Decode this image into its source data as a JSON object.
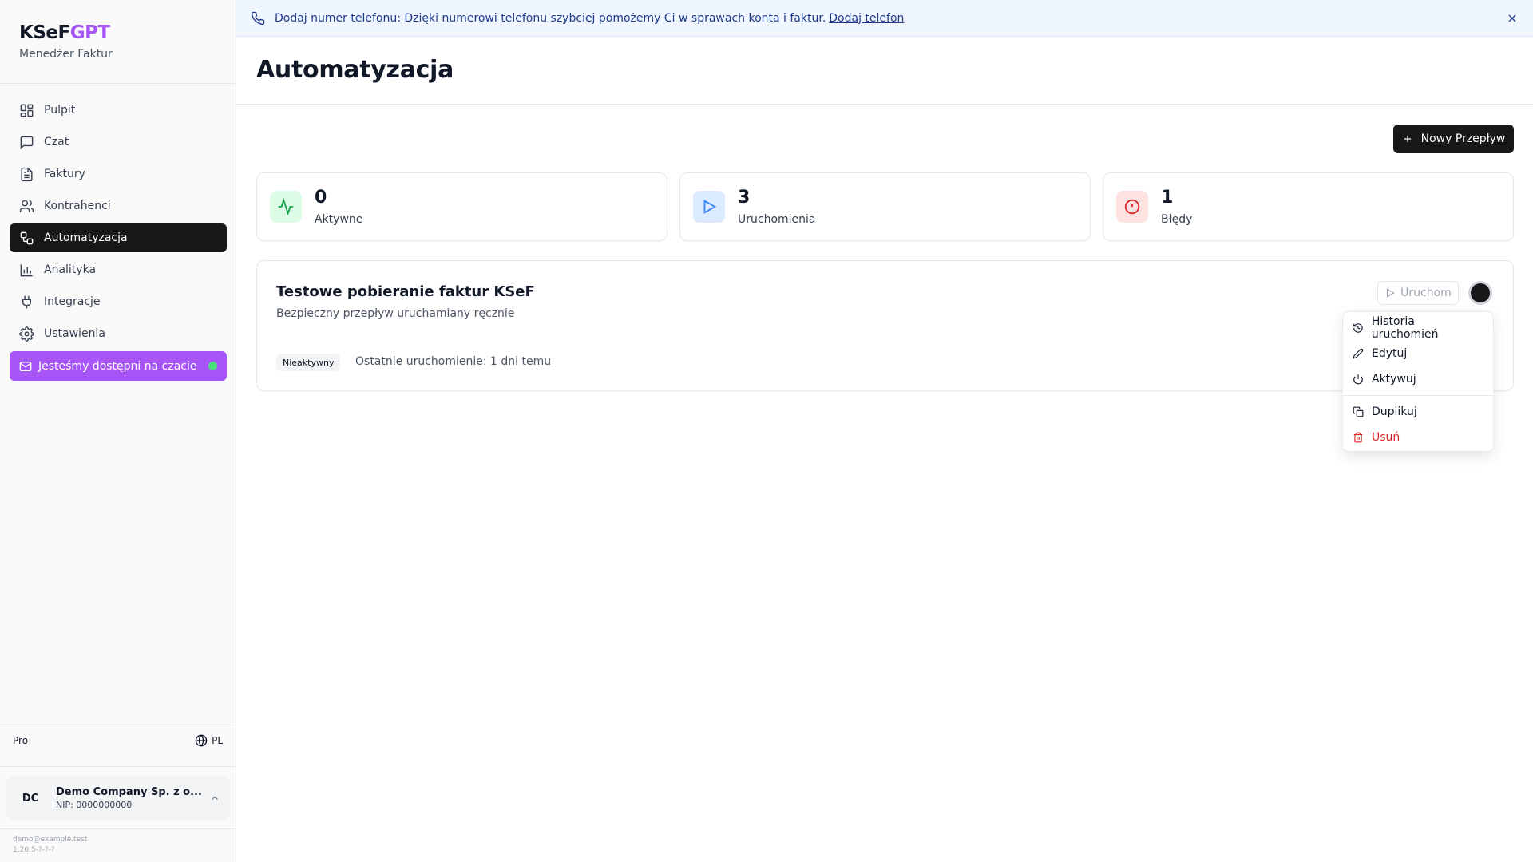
{
  "brand": {
    "logo_main": "KSeF",
    "logo_accent": "GPT",
    "subtitle": "Menedżer Faktur"
  },
  "sidebar": {
    "items": [
      {
        "label": "Pulpit",
        "icon": "dashboard-icon"
      },
      {
        "label": "Czat",
        "icon": "message-icon"
      },
      {
        "label": "Faktury",
        "icon": "file-text-icon"
      },
      {
        "label": "Kontrahenci",
        "icon": "users-icon"
      },
      {
        "label": "Automatyzacja",
        "icon": "workflow-icon",
        "active": true
      },
      {
        "label": "Analityka",
        "icon": "bar-chart-icon"
      },
      {
        "label": "Integracje",
        "icon": "plug-icon"
      },
      {
        "label": "Ustawienia",
        "icon": "gear-icon"
      }
    ],
    "chat_cta": "Jesteśmy dostępni na czacie",
    "plan": "Pro",
    "language": "PL",
    "company": {
      "initials": "DC",
      "name": "Demo Company Sp. z o...",
      "nip": "NIP: 0000000000"
    },
    "email": "demo@example.test",
    "version": "1.20.5-?-?-?"
  },
  "banner": {
    "text": "Dodaj numer telefonu: Dzięki numerowi telefonu szybciej pomożemy Ci w sprawach konta i faktur.",
    "link": "Dodaj telefon"
  },
  "header": {
    "title": "Automatyzacja",
    "new_flow_label": "Nowy Przepływ"
  },
  "stats": [
    {
      "value": "0",
      "label": "Aktywne",
      "icon": "activity-icon",
      "color": "#16a34a",
      "bg": "#dcfce7"
    },
    {
      "value": "3",
      "label": "Uruchomienia",
      "icon": "play-icon",
      "color": "#3b82f6",
      "bg": "#dbeafe"
    },
    {
      "value": "1",
      "label": "Błędy",
      "icon": "alert-circle-icon",
      "color": "#dc2626",
      "bg": "#fee2e2"
    }
  ],
  "flow": {
    "title": "Testowe pobieranie faktur KSeF",
    "description": "Bezpieczny przepływ uruchamiany ręcznie",
    "status": "Nieaktywny",
    "last_run": "Ostatnie uruchomienie: 1 dni temu",
    "run_label": "Uruchom"
  },
  "menu": {
    "items": [
      {
        "label": "Historia uruchomień",
        "icon": "history-icon"
      },
      {
        "label": "Edytuj",
        "icon": "pencil-icon"
      },
      {
        "label": "Aktywuj",
        "icon": "power-icon"
      },
      {
        "label": "Duplikuj",
        "icon": "copy-icon"
      },
      {
        "label": "Usuń",
        "icon": "trash-icon",
        "danger": true
      }
    ]
  }
}
